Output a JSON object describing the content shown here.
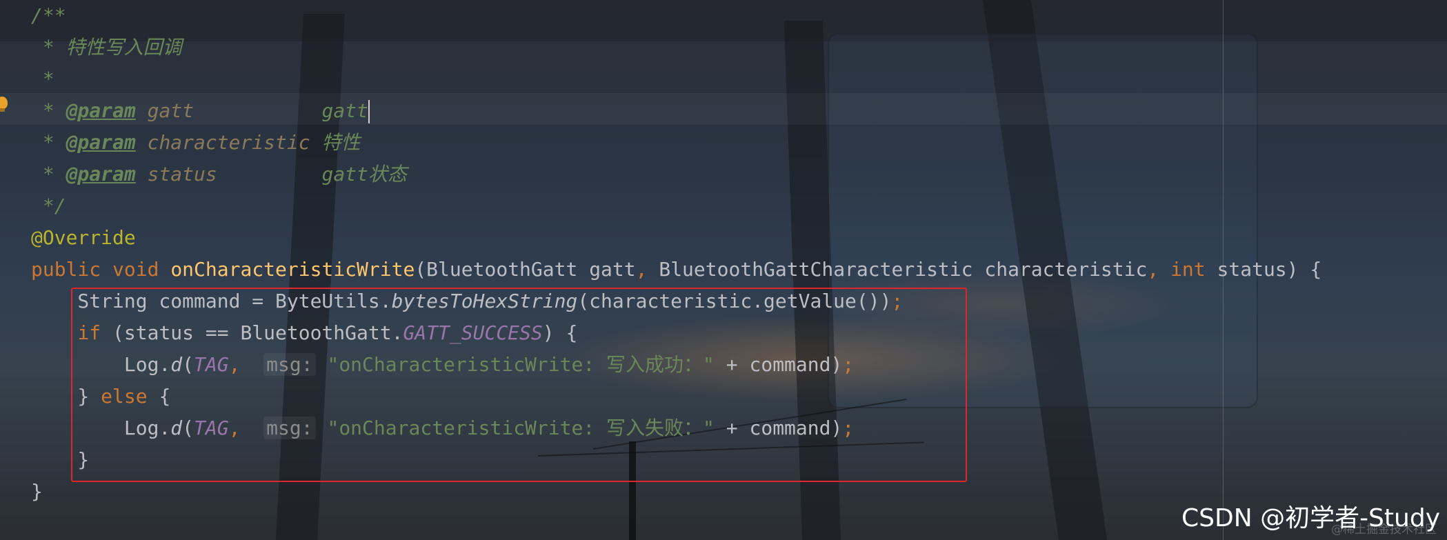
{
  "editor": {
    "lines": [
      {
        "id": "doc-open",
        "tokens": [
          {
            "t": "/**",
            "c": "cm"
          }
        ]
      },
      {
        "id": "doc-desc",
        "tokens": [
          {
            "t": " * 特性写入回调",
            "c": "cm"
          }
        ]
      },
      {
        "id": "doc-blank",
        "tokens": [
          {
            "t": " *",
            "c": "cm"
          }
        ]
      },
      {
        "id": "doc-param-gatt",
        "tokens": [
          {
            "t": " * ",
            "c": "cm"
          },
          {
            "t": "@param",
            "c": "tag"
          },
          {
            "t": " ",
            "c": "cm"
          },
          {
            "t": "gatt",
            "c": "pn"
          },
          {
            "t": "           gatt",
            "c": "cm"
          }
        ],
        "caret": true
      },
      {
        "id": "doc-param-characteristic",
        "tokens": [
          {
            "t": " * ",
            "c": "cm"
          },
          {
            "t": "@param",
            "c": "tag"
          },
          {
            "t": " ",
            "c": "cm"
          },
          {
            "t": "characteristic",
            "c": "pn"
          },
          {
            "t": " 特性",
            "c": "cm"
          }
        ]
      },
      {
        "id": "doc-param-status",
        "tokens": [
          {
            "t": " * ",
            "c": "cm"
          },
          {
            "t": "@param",
            "c": "tag"
          },
          {
            "t": " ",
            "c": "cm"
          },
          {
            "t": "status",
            "c": "pn"
          },
          {
            "t": "         gatt状态",
            "c": "cm"
          }
        ]
      },
      {
        "id": "doc-close",
        "tokens": [
          {
            "t": " */",
            "c": "cm"
          }
        ]
      },
      {
        "id": "override",
        "tokens": [
          {
            "t": "@Override",
            "c": "ann"
          }
        ]
      },
      {
        "id": "method-signature",
        "tokens": [
          {
            "t": "public",
            "c": "kw"
          },
          {
            "t": " ",
            "c": ""
          },
          {
            "t": "void",
            "c": "kw"
          },
          {
            "t": " ",
            "c": ""
          },
          {
            "t": "onCharacteristicWrite",
            "c": "fn"
          },
          {
            "t": "(BluetoothGatt gatt",
            "c": ""
          },
          {
            "t": ",",
            "c": "kw"
          },
          {
            "t": " BluetoothGattCharacteristic characteristic",
            "c": ""
          },
          {
            "t": ",",
            "c": "kw"
          },
          {
            "t": " ",
            "c": ""
          },
          {
            "t": "int",
            "c": "kw"
          },
          {
            "t": " status) {",
            "c": ""
          }
        ]
      },
      {
        "id": "command-line",
        "tokens": [
          {
            "t": "    String command = ByteUtils.",
            "c": ""
          },
          {
            "t": "bytesToHexString",
            "c": "it"
          },
          {
            "t": "(characteristic.getValue())",
            "c": ""
          },
          {
            "t": ";",
            "c": "kw"
          }
        ]
      },
      {
        "id": "if-line",
        "tokens": [
          {
            "t": "    ",
            "c": ""
          },
          {
            "t": "if",
            "c": "kw"
          },
          {
            "t": " (status == BluetoothGatt.",
            "c": ""
          },
          {
            "t": "GATT_SUCCESS",
            "c": "cn"
          },
          {
            "t": ") {",
            "c": ""
          }
        ]
      },
      {
        "id": "log-success",
        "tokens": [
          {
            "t": "        Log.",
            "c": ""
          },
          {
            "t": "d",
            "c": "it"
          },
          {
            "t": "(",
            "c": ""
          },
          {
            "t": "TAG",
            "c": "cn"
          },
          {
            "t": ",",
            "c": "kw"
          },
          {
            "t": "  ",
            "c": ""
          },
          {
            "t": "msg:",
            "c": "hint"
          },
          {
            "t": " ",
            "c": ""
          },
          {
            "t": "\"onCharacteristicWrite: 写入成功：\"",
            "c": "str"
          },
          {
            "t": " + command)",
            "c": ""
          },
          {
            "t": ";",
            "c": "kw"
          }
        ]
      },
      {
        "id": "else-line",
        "tokens": [
          {
            "t": "    } ",
            "c": ""
          },
          {
            "t": "else",
            "c": "kw"
          },
          {
            "t": " {",
            "c": ""
          }
        ]
      },
      {
        "id": "log-fail",
        "tokens": [
          {
            "t": "        Log.",
            "c": ""
          },
          {
            "t": "d",
            "c": "it"
          },
          {
            "t": "(",
            "c": ""
          },
          {
            "t": "TAG",
            "c": "cn"
          },
          {
            "t": ",",
            "c": "kw"
          },
          {
            "t": "  ",
            "c": ""
          },
          {
            "t": "msg:",
            "c": "hint"
          },
          {
            "t": " ",
            "c": ""
          },
          {
            "t": "\"onCharacteristicWrite: 写入失败：\"",
            "c": "str"
          },
          {
            "t": " + command)",
            "c": ""
          },
          {
            "t": ";",
            "c": "kw"
          }
        ]
      },
      {
        "id": "if-close",
        "tokens": [
          {
            "t": "    }",
            "c": ""
          }
        ]
      },
      {
        "id": "method-close",
        "tokens": [
          {
            "t": "}",
            "c": ""
          }
        ]
      }
    ]
  },
  "watermark": {
    "main": "CSDN @初学者-Study",
    "faint": "@稀土掘金技术社区"
  },
  "icons": {
    "gutter": "intention-bulb-icon"
  },
  "colors": {
    "keyword": "#cc7832",
    "method": "#ffc66d",
    "annotation": "#bbb529",
    "comment": "#6a8759",
    "constant": "#9876aa",
    "highlight_box": "#e0262c"
  }
}
